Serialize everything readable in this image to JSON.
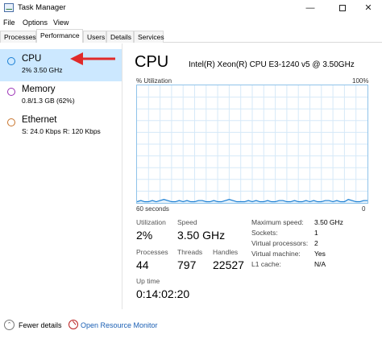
{
  "window": {
    "title": "Task Manager",
    "min_glyph": "—",
    "close_glyph": "✕"
  },
  "menu": [
    "File",
    "Options",
    "View"
  ],
  "tabs": [
    "Processes",
    "Performance",
    "Users",
    "Details",
    "Services"
  ],
  "active_tab": "Performance",
  "resources": [
    {
      "name": "CPU",
      "sub": "2%  3.50 GHz",
      "color": "#1a7fd4",
      "selected": true
    },
    {
      "name": "Memory",
      "sub": "0.8/1.3 GB (62%)",
      "color": "#9b30b5",
      "selected": false
    },
    {
      "name": "Ethernet",
      "sub": "S: 24.0 Kbps  R: 120 Kbps",
      "color": "#c8732a",
      "selected": false
    }
  ],
  "annotation": {
    "arrow_color": "#e02a2a"
  },
  "cpu": {
    "title": "CPU",
    "model": "Intel(R) Xeon(R) CPU E3-1240 v5 @ 3.50GHz",
    "util_label": "% Utilization",
    "util_max": "100%",
    "time_left": "60 seconds",
    "time_right": "0",
    "graph_color": "#1a7fd4",
    "grid_color": "#d6e9f8",
    "utilization_history": [
      1,
      2,
      1,
      1,
      2,
      1,
      2,
      3,
      2,
      1,
      1,
      2,
      1,
      2,
      1,
      1,
      2,
      2,
      1,
      1,
      2,
      1,
      1,
      2,
      3,
      2,
      1,
      1,
      1,
      2,
      1,
      2,
      1,
      1,
      2,
      1,
      1,
      2,
      2,
      1,
      1,
      2,
      1,
      1,
      2,
      1,
      2,
      1,
      1,
      2,
      2,
      1,
      2,
      1,
      1,
      3,
      2,
      1,
      1,
      2,
      2
    ],
    "stats": {
      "utilization_label": "Utilization",
      "utilization_value": "2%",
      "speed_label": "Speed",
      "speed_value": "3.50 GHz",
      "processes_label": "Processes",
      "processes_value": "44",
      "threads_label": "Threads",
      "threads_value": "797",
      "handles_label": "Handles",
      "handles_value": "22527",
      "uptime_label": "Up time",
      "uptime_value": "0:14:02:20"
    },
    "specs": [
      {
        "label": "Maximum speed:",
        "value": "3.50 GHz"
      },
      {
        "label": "Sockets:",
        "value": "1"
      },
      {
        "label": "Virtual processors:",
        "value": "2"
      },
      {
        "label": "Virtual machine:",
        "value": "Yes"
      },
      {
        "label": "L1 cache:",
        "value": "N/A"
      }
    ]
  },
  "footer": {
    "fewer_details": "Fewer details",
    "open_monitor": "Open Resource Monitor"
  }
}
